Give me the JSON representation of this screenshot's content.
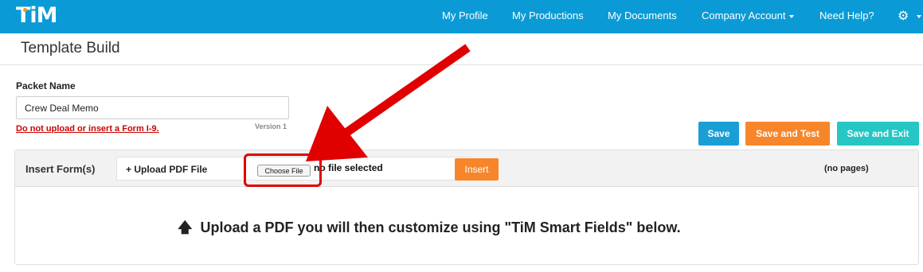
{
  "app": {
    "logo_text": "TiM"
  },
  "nav": {
    "items": [
      {
        "label": "My Profile"
      },
      {
        "label": "My Productions"
      },
      {
        "label": "My Documents"
      },
      {
        "label": "Company Account"
      },
      {
        "label": "Need Help?"
      }
    ],
    "settings_icon": "gear-icon"
  },
  "page": {
    "title": "Template Build"
  },
  "form": {
    "packet_name_label": "Packet Name",
    "packet_name_value": "Crew Deal Memo",
    "warning": "Do not upload or insert a Form I-9.",
    "version": "Version 1"
  },
  "actions": {
    "save": "Save",
    "save_and_test": "Save and Test",
    "save_and_exit": "Save and Exit"
  },
  "insert_panel": {
    "label": "Insert Form(s)",
    "upload_label": "+ Upload PDF File",
    "choose_file": "Choose File",
    "file_status": "no file selected",
    "insert_button": "Insert",
    "pages": "(no pages)",
    "instruction": "Upload a PDF you will then customize using \"TiM Smart Fields\" below."
  },
  "colors": {
    "nav": "#0a9bd6",
    "save": "#1a9ed6",
    "save_and_test": "#f7862b",
    "save_and_exit": "#25c6c4",
    "annotation": "#e10000"
  }
}
